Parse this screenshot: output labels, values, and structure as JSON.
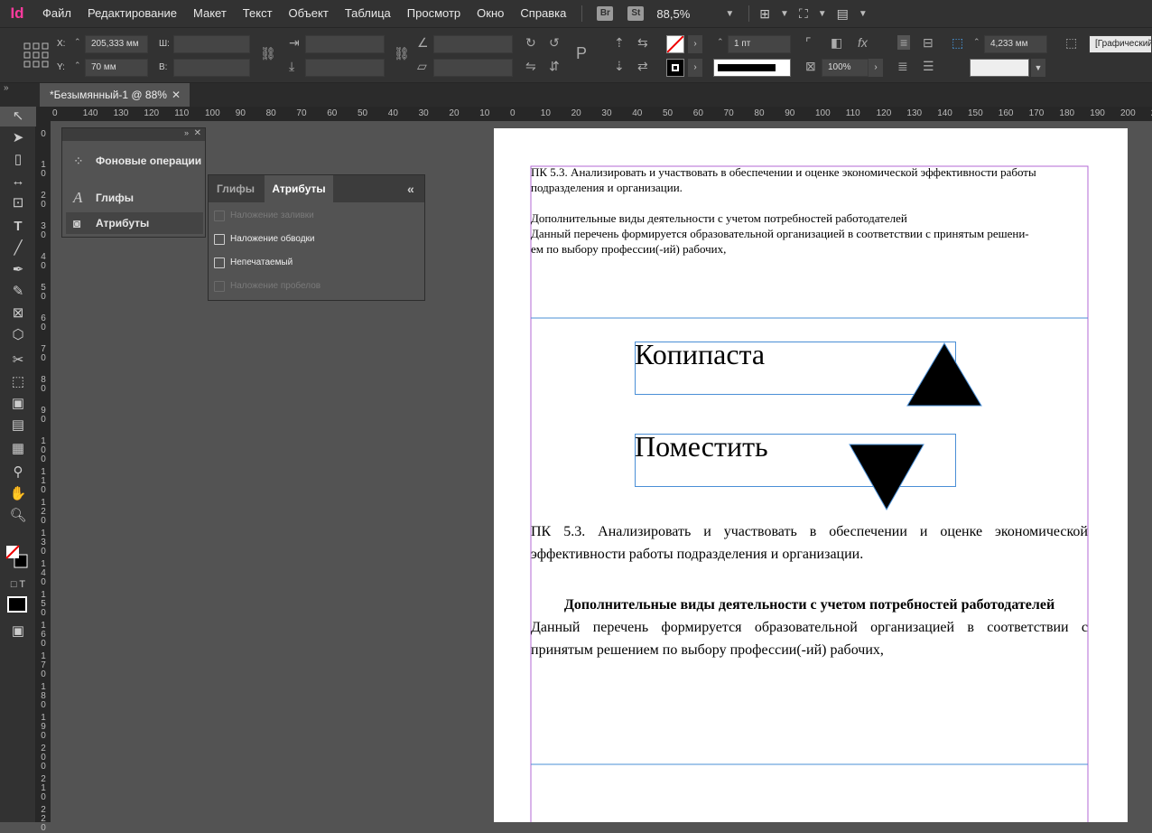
{
  "app": {
    "logo": "Id"
  },
  "menu": [
    "Файл",
    "Редактирование",
    "Макет",
    "Текст",
    "Объект",
    "Таблица",
    "Просмотр",
    "Окно",
    "Справка"
  ],
  "menubar": {
    "bridge": "Br",
    "stock": "St",
    "zoom": "88,5%"
  },
  "control": {
    "x_label": "X:",
    "x_value": "205,333 мм",
    "y_label": "Y:",
    "y_value": "70 мм",
    "w_label": "Ш:",
    "h_label": "В:",
    "stroke_weight": "1 пт",
    "scale": "100%",
    "offset": "4,233 мм",
    "style": "[Графический"
  },
  "doc_tab": {
    "title": "*Безымянный-1 @ 88%",
    "close": "✕"
  },
  "ruler": {
    "h_ticks": [
      "0",
      "140",
      "130",
      "120",
      "110",
      "100",
      "90",
      "80",
      "70",
      "60",
      "50",
      "40",
      "30",
      "20",
      "10",
      "0",
      "10",
      "20",
      "30",
      "40",
      "50",
      "60",
      "70",
      "80",
      "90",
      "100",
      "110",
      "120",
      "130",
      "140",
      "150",
      "160",
      "170",
      "180",
      "190",
      "200",
      "210"
    ],
    "v_ticks": [
      "0",
      "1\n0",
      "2\n0",
      "3\n0",
      "4\n0",
      "5\n0",
      "6\n0",
      "7\n0",
      "8\n0",
      "9\n0",
      "1\n0\n0",
      "1\n1\n0",
      "1\n2\n0",
      "1\n3\n0",
      "1\n4\n0",
      "1\n5\n0",
      "1\n6\n0",
      "1\n7\n0",
      "1\n8\n0",
      "1\n9\n0",
      "2\n0\n0",
      "2\n1\n0",
      "2\n2\n0"
    ]
  },
  "panel_stack": {
    "items": [
      "Фоновые операции",
      "Глифы",
      "Атрибуты"
    ]
  },
  "attributes_panel": {
    "tabs": [
      "Глифы",
      "Атрибуты"
    ],
    "collapse": "«",
    "options": [
      {
        "label": "Наложение заливки",
        "enabled": false
      },
      {
        "label": "Наложение обводки",
        "enabled": true
      },
      {
        "label": "Непечатаемый",
        "enabled": true
      },
      {
        "label": "Наложение пробелов",
        "enabled": false
      }
    ]
  },
  "page": {
    "small_line1": "ПК 5.3. Анализировать и участвовать в обеспечении и оценке экономической эффективности работы",
    "small_line2": "подразделения и организации.",
    "small_line3": "Дополнительные виды деятельности с учетом потребностей работодателей",
    "small_line4": "Данный перечень формируется образовательной организацией в соответствии с принятым решени-",
    "small_line5": "ем по выбору профессии(-ий) рабочих,",
    "btn_copy": "Копипаста",
    "btn_place": "Поместить",
    "big_line1": "ПК 5.3. Анализировать и участвовать в обеспечении и оценке экономической",
    "big_line2": "эффективности работы подразделения и организации.",
    "big_heading": "Дополнительные виды деятельности с учетом потребностей работодателей",
    "big_line3": "Данный перечень формируется образовательной организацией в соответствии с",
    "big_line4": "принятым решением по выбору профессии(-ий) рабочих,"
  },
  "colors": {
    "accent": "#ff3b9e",
    "frame": "#4a8fd6",
    "margin": "#b36ad6"
  }
}
